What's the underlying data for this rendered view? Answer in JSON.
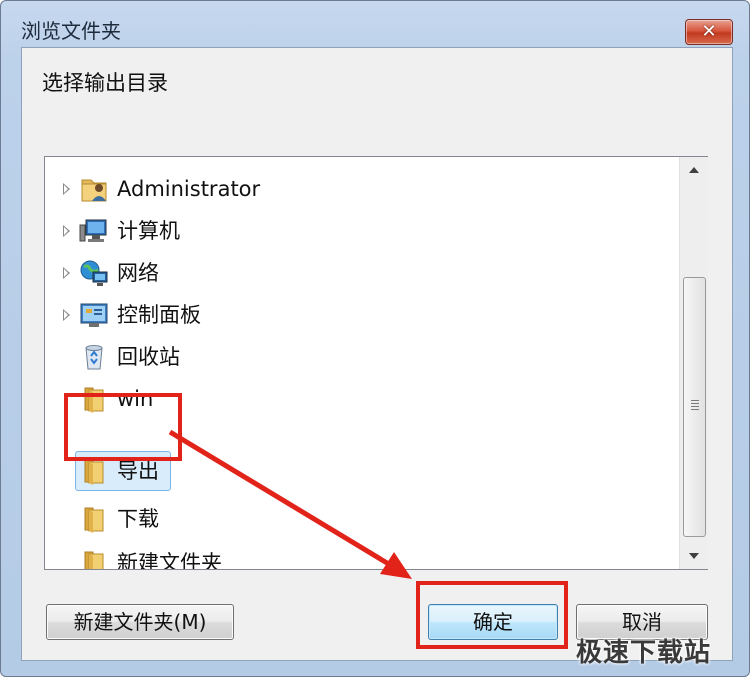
{
  "window": {
    "title": "浏览文件夹",
    "close_icon": "close-icon",
    "close_glyph": "✕"
  },
  "dialog": {
    "prompt": "选择输出目录"
  },
  "tree": {
    "items": [
      {
        "label": "Administrator",
        "icon": "user-folder-icon",
        "expandable": true
      },
      {
        "label": "计算机",
        "icon": "computer-icon",
        "expandable": true
      },
      {
        "label": "网络",
        "icon": "network-icon",
        "expandable": true
      },
      {
        "label": "控制面板",
        "icon": "control-panel-icon",
        "expandable": true
      },
      {
        "label": "回收站",
        "icon": "recycle-bin-icon",
        "expandable": false
      },
      {
        "label": "win",
        "icon": "folder-icon",
        "expandable": false
      },
      {
        "label": "导出",
        "icon": "folder-icon",
        "expandable": false,
        "selected": true
      },
      {
        "label": "下载",
        "icon": "folder-icon",
        "expandable": false
      },
      {
        "label": "新建文件夹",
        "icon": "folder-icon",
        "expandable": false
      }
    ],
    "selected_item": "导出"
  },
  "buttons": {
    "new_folder": "新建文件夹(M)",
    "ok": "确定",
    "cancel": "取消"
  },
  "annotation": {
    "highlight_color": "#e2231a"
  },
  "watermark": "极速下载站"
}
